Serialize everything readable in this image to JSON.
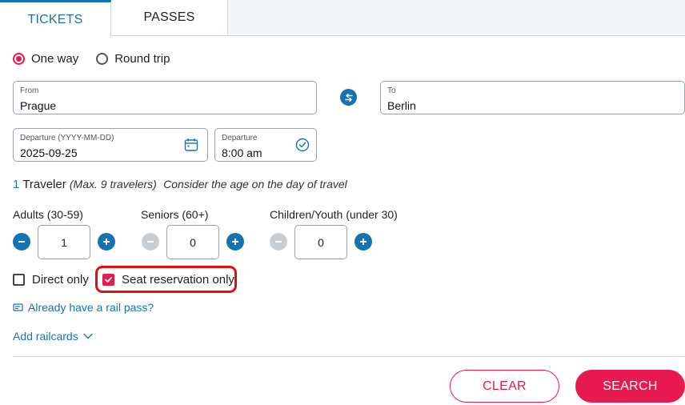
{
  "tabs": {
    "tickets": "TICKETS",
    "passes": "PASSES"
  },
  "trip_type": {
    "one_way": "One way",
    "round_trip": "Round trip",
    "selected": "One way"
  },
  "from": {
    "label": "From",
    "value": "Prague"
  },
  "to": {
    "label": "To",
    "value": "Berlin"
  },
  "departure_date": {
    "label": "Departure (YYYY-MM-DD)",
    "value": "2025-09-25"
  },
  "departure_time": {
    "label": "Departure",
    "value": "8:00 am"
  },
  "travelers": {
    "count": "1",
    "word": "Traveler",
    "max_note": "(Max. 9 travelers)",
    "age_note": "Consider the age on the day of travel",
    "groups": [
      {
        "label": "Adults (30-59)",
        "value": "1",
        "minus_enabled": true
      },
      {
        "label": "Seniors (60+)",
        "value": "0",
        "minus_enabled": false
      },
      {
        "label": "Children/Youth (under 30)",
        "value": "0",
        "minus_enabled": false
      }
    ]
  },
  "options": {
    "direct_only": {
      "label": "Direct only",
      "checked": false
    },
    "seat_reservation_only": {
      "label": "Seat reservation only",
      "checked": true
    }
  },
  "links": {
    "rail_pass": "Already have a rail pass?",
    "railcards": "Add railcards"
  },
  "buttons": {
    "clear": "CLEAR",
    "search": "SEARCH"
  },
  "colors": {
    "accent_blue": "#1673b1",
    "accent_pink": "#e8194f",
    "highlight_red": "#e01010"
  }
}
